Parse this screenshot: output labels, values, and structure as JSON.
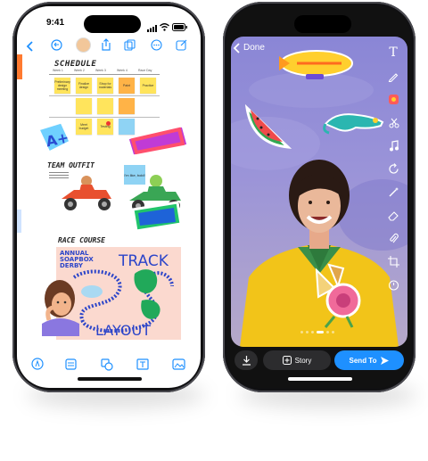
{
  "left_phone": {
    "status": {
      "time": "9:41"
    },
    "board": {
      "schedule_heading": "SCHEDULE",
      "week_columns": [
        "Week 1",
        "Week 2",
        "Week 3",
        "Week 4",
        "Race Day"
      ],
      "notes": [
        [
          "Preliminary design meeting",
          "Finalize design",
          "Shop for materials",
          "Paint",
          "Practice"
        ],
        [
          "",
          "",
          "",
          "",
          ""
        ],
        [
          "",
          "Meet budget",
          "Testing",
          "",
          ""
        ]
      ],
      "team_heading": "TEAM OUTFIT",
      "sticky_note": "I'm like, bold!",
      "race_heading": "RACE COURSE",
      "map_title_lines": [
        "ANNUAL",
        "SOAPBOX",
        "DERBY"
      ],
      "map_track_word": "TRACK",
      "map_layout_word": "LAYOUT"
    }
  },
  "right_phone": {
    "done_label": "Done",
    "story_label": "Story",
    "send_label": "Send To"
  },
  "colors": {
    "accent_blue": "#1e90ff",
    "note_yellow": "#ffe45c",
    "note_orange": "#ffb347"
  }
}
